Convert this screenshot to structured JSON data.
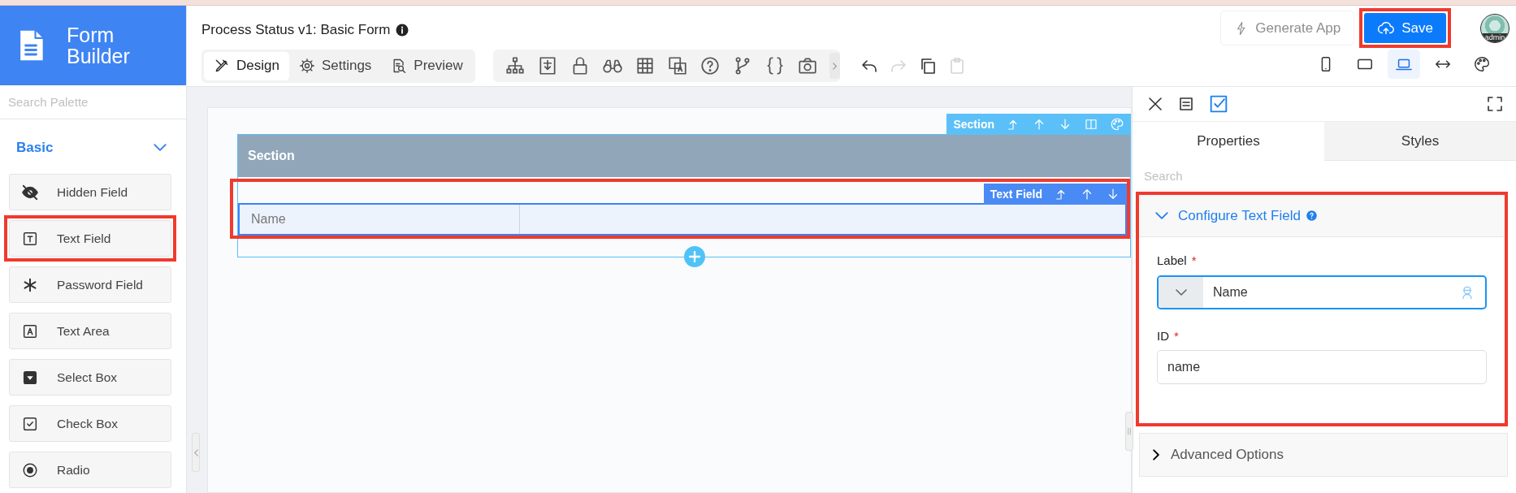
{
  "brand": {
    "title": "Form Builder"
  },
  "header": {
    "title": "Process Status v1: Basic Form",
    "mode_tabs": [
      {
        "label": "Design",
        "kind": "design",
        "selected": true
      },
      {
        "label": "Settings",
        "kind": "settings",
        "selected": false
      },
      {
        "label": "Preview",
        "kind": "preview",
        "selected": false
      }
    ],
    "edit_actions": [
      {
        "kind": "undo",
        "disabled": false
      },
      {
        "kind": "redo",
        "disabled": true
      },
      {
        "kind": "copy",
        "disabled": false
      },
      {
        "kind": "paste",
        "disabled": true
      }
    ],
    "generate_button": {
      "label": "Generate App",
      "disabled": true
    },
    "save_button": {
      "label": "Save",
      "highlighted": true
    },
    "avatar": {
      "text": "admin"
    },
    "device_views": [
      {
        "kind": "phone",
        "selected": false
      },
      {
        "kind": "tablet",
        "selected": false
      },
      {
        "kind": "laptop",
        "selected": true
      },
      {
        "kind": "full-width",
        "selected": false
      }
    ]
  },
  "palette": {
    "search_placeholder": "Search Palette",
    "group": {
      "label": "Basic",
      "expanded": true
    },
    "items": [
      {
        "label": "Hidden Field",
        "kind": "hidden",
        "highlighted": false
      },
      {
        "label": "Text Field",
        "kind": "text",
        "highlighted": true
      },
      {
        "label": "Password Field",
        "kind": "password",
        "highlighted": false
      },
      {
        "label": "Text Area",
        "kind": "textarea",
        "highlighted": false
      },
      {
        "label": "Select Box",
        "kind": "select",
        "highlighted": false
      },
      {
        "label": "Check Box",
        "kind": "checkbox",
        "highlighted": false
      },
      {
        "label": "Radio",
        "kind": "radio",
        "highlighted": false
      }
    ]
  },
  "canvas": {
    "section": {
      "toolbar_label": "Section",
      "title": "Section",
      "field": {
        "toolbar_label": "Text Field",
        "label": "Name",
        "highlighted": true
      }
    }
  },
  "properties": {
    "toggle_checked": true,
    "tabs": [
      {
        "label": "Properties",
        "selected": true
      },
      {
        "label": "Styles",
        "selected": false
      }
    ],
    "search_placeholder": "Search",
    "configure": {
      "title": "Configure Text Field",
      "expanded": true,
      "highlighted": true,
      "fields": [
        {
          "label": "Label",
          "required_mark": "*",
          "value": "Name",
          "kind": "translatable",
          "focused": true
        },
        {
          "label": "ID",
          "required_mark": "*",
          "value": "name",
          "kind": "plain",
          "focused": false
        }
      ]
    },
    "advanced": {
      "title": "Advanced Options",
      "expanded": false
    }
  }
}
